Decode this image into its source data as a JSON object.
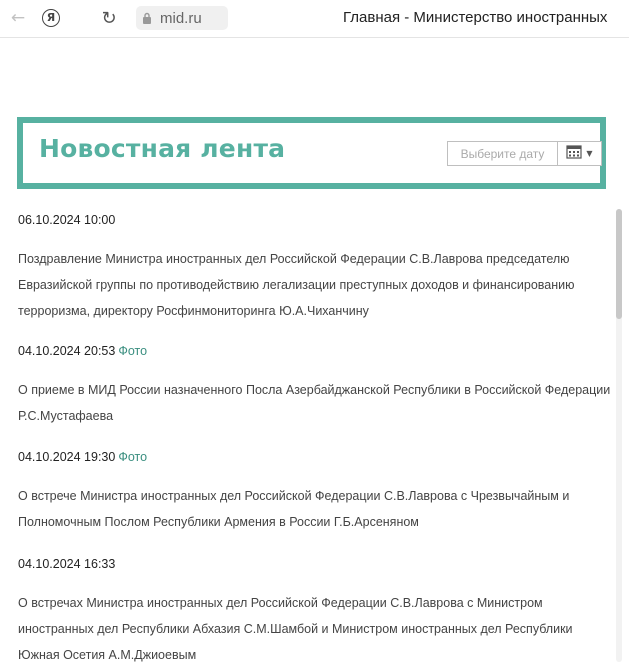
{
  "browser": {
    "url": "mid.ru",
    "tab_title": "Главная - Министерство иностранных"
  },
  "news_header": {
    "title": "Новостная лента",
    "date_placeholder": "Выберите дату"
  },
  "news": [
    {
      "date": "06.10.2024 10:00",
      "photo": "",
      "text": "Поздравление Министра иностранных дел Российской Федерации С.В.Лаврова председателю Евразийской группы по противодействию легализации преступных доходов и финансированию терроризма, директору Росфинмониторинга Ю.А.Чиханчину"
    },
    {
      "date": "04.10.2024 20:53",
      "photo": "Фото",
      "text": "О приеме в МИД России назначенного Посла Азербайджанской Республики в Российской Федерации Р.С.Мустафаева"
    },
    {
      "date": "04.10.2024 19:30",
      "photo": "Фото",
      "text": "О встрече Министра иностранных дел Российской Федерации С.В.Лаврова с Чрезвычайным и Полномочным Послом Республики Армения в России Г.Б.Арсеняном"
    },
    {
      "date": "04.10.2024 16:33",
      "photo": "",
      "text": "О встречах Министра иностранных дел Российской Федерации С.В.Лаврова с Министром иностранных дел Республики Абхазия С.М.Шамбой и Министром иностранных дел Республики Южная Осетия А.М.Джиоевым"
    }
  ]
}
